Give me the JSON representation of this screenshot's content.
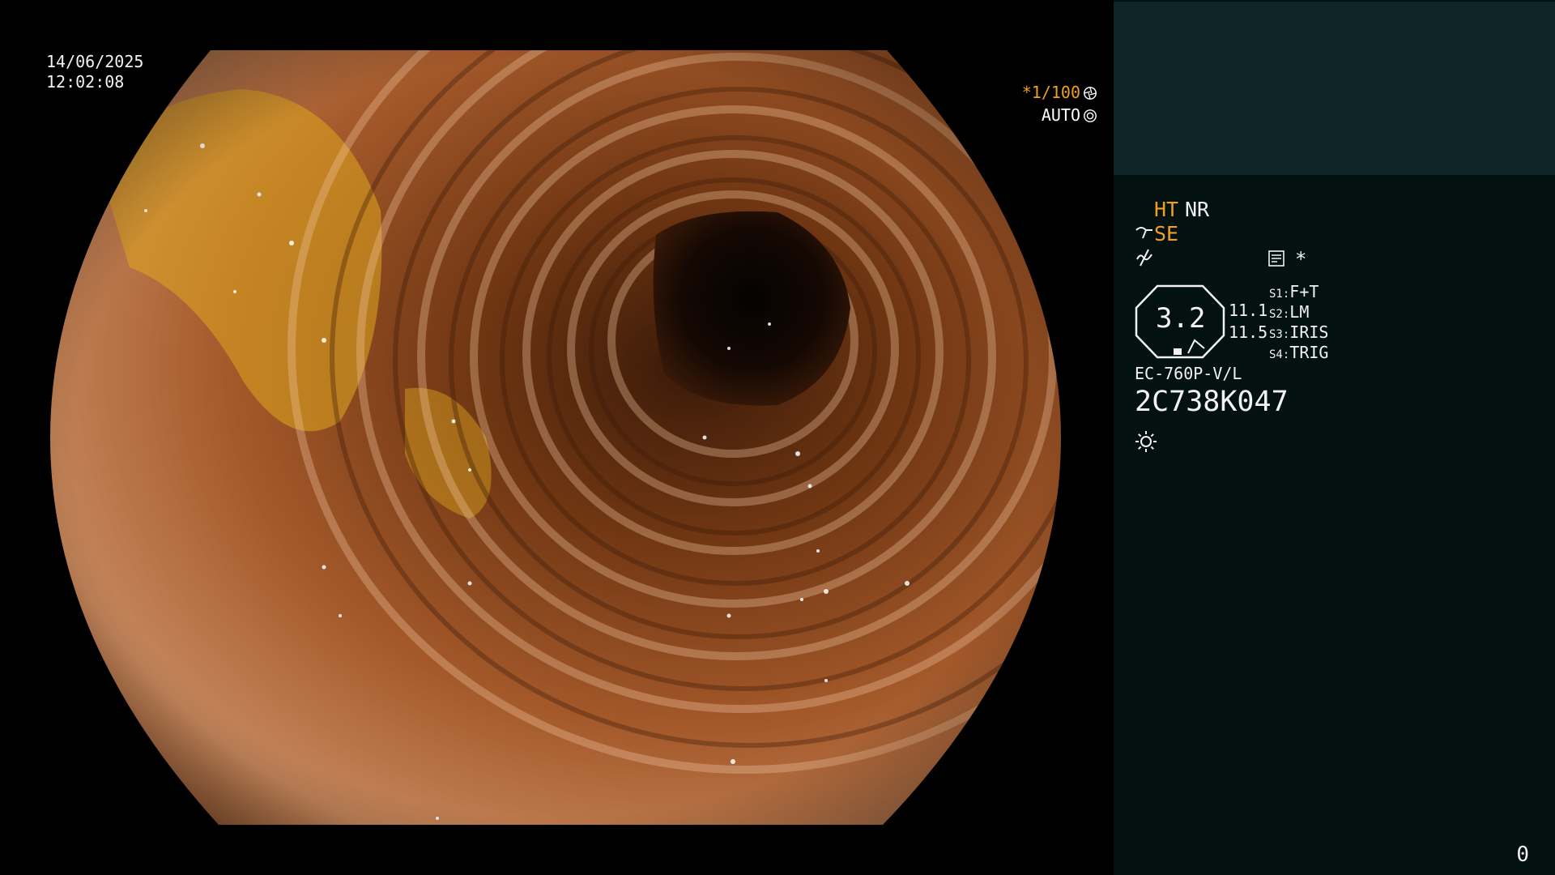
{
  "overlay": {
    "date": "14/06/2025",
    "time": "12:02:08",
    "shutter": "*1/100",
    "exposure_mode": "AUTO",
    "shutter_icon": "aperture-icon",
    "auto_icon": "iris-icon"
  },
  "panel": {
    "ht": "HT",
    "nr": "NR",
    "se": "SE",
    "se_icon": "scope-arrow-icon",
    "wave_icon": "wave-icon",
    "memory_icon": "memory-icon",
    "star": "*",
    "zoom_value": "3.2",
    "value_a": "11.1",
    "value_b": "11.5",
    "switches": [
      {
        "key": "S1:",
        "value": "F+T"
      },
      {
        "key": "S2:",
        "value": "LM"
      },
      {
        "key": "S3:",
        "value": "IRIS"
      },
      {
        "key": "S4:",
        "value": "TRIG"
      }
    ],
    "model": "EC-760P-V/L",
    "serial": "2C738K047",
    "light_icon": "sun-icon",
    "counter": "0"
  },
  "colors": {
    "accent": "#f0a020",
    "panel_bg": "#031210",
    "panel_top_bg": "#0e2527",
    "mucosa_light": "#d9a078",
    "mucosa_dark": "#5a2a0e",
    "bile": "#e0a81f"
  }
}
